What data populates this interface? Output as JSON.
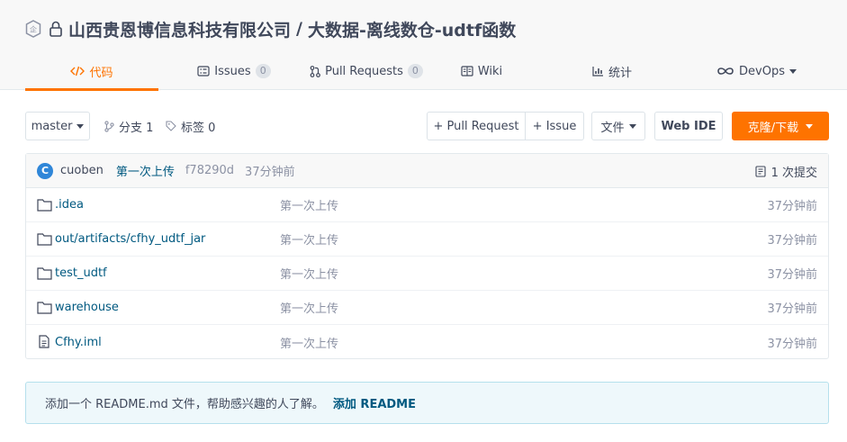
{
  "repo": {
    "owner": "山西贵恩博信息科技有限公司",
    "separator": "/",
    "name": "大数据-离线数仓-udtf函数"
  },
  "tabs": [
    {
      "label": "代码",
      "icon": "code-icon",
      "active": true
    },
    {
      "label": "Issues",
      "icon": "issues-icon",
      "count": "0"
    },
    {
      "label": "Pull Requests",
      "icon": "pull-request-icon",
      "count": "0"
    },
    {
      "label": "Wiki",
      "icon": "wiki-icon"
    },
    {
      "label": "统计",
      "icon": "stats-icon"
    },
    {
      "label": "DevOps",
      "icon": "devops-icon"
    }
  ],
  "toolbar": {
    "branch": "master",
    "branches_label": "分支 1",
    "tags_label": "标签 0",
    "pull_request_label": "+ Pull Request",
    "issue_label": "+ Issue",
    "file_label": "文件",
    "web_ide_label": "Web IDE",
    "clone_label": "克隆/下载"
  },
  "commit": {
    "avatar_letter": "C",
    "author": "cuoben",
    "message": "第一次上传",
    "hash": "f78290d",
    "time": "37分钟前",
    "count_label": "1 次提交"
  },
  "files": [
    {
      "type": "folder",
      "name": ".idea",
      "message": "第一次上传",
      "time": "37分钟前"
    },
    {
      "type": "folder",
      "name": "out/artifacts/cfhy_udtf_jar",
      "message": "第一次上传",
      "time": "37分钟前"
    },
    {
      "type": "folder",
      "name": "test_udtf",
      "message": "第一次上传",
      "time": "37分钟前"
    },
    {
      "type": "folder",
      "name": "warehouse",
      "message": "第一次上传",
      "time": "37分钟前"
    },
    {
      "type": "file",
      "name": "Cfhy.iml",
      "message": "第一次上传",
      "time": "37分钟前"
    }
  ],
  "readme_tip": {
    "text": "添加一个 README.md 文件，帮助感兴趣的人了解。",
    "link": "添加 README"
  },
  "colors": {
    "accent": "#fe7300",
    "link": "#005980",
    "muted": "#8c92a4",
    "text": "#40485b"
  }
}
